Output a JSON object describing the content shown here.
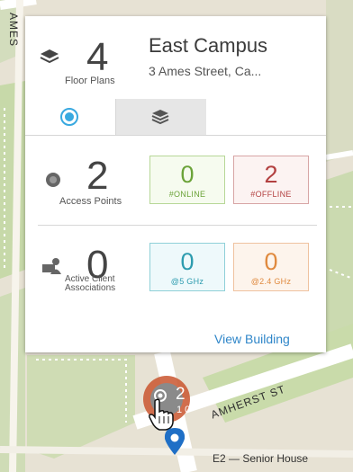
{
  "map": {
    "street_top_left": "AMES",
    "street_right": "AMHERST ST",
    "place_label": "E2 — Senior House",
    "colors": {
      "land": "#e9e4d8",
      "park": "#c9dcae",
      "road": "#ffffff"
    }
  },
  "header": {
    "floor_plans_count": "4",
    "floor_plans_label": "Floor Plans",
    "building_name": "East Campus",
    "building_address": "3 Ames Street, Ca..."
  },
  "tabs": [
    {
      "icon": "access-point-icon",
      "active": true
    },
    {
      "icon": "layers-icon",
      "active": false
    }
  ],
  "access_points": {
    "count": "2",
    "label": "Access Points",
    "online_value": "0",
    "online_label": "#ONLINE",
    "offline_value": "2",
    "offline_label": "#OFFLINE"
  },
  "clients": {
    "count": "0",
    "label_line1": "Active Client",
    "label_line2": "Associations",
    "ghz5_value": "0",
    "ghz5_label": "@5 GHz",
    "ghz24_value": "0",
    "ghz24_label": "@2.4 GHz"
  },
  "footer": {
    "link_label": "View Building"
  },
  "marker": {
    "count": "2",
    "sub": "1 0",
    "color": "#c9552e"
  },
  "colors": {
    "online": "#6ba339",
    "offline": "#b34141",
    "ghz5": "#2d9caf",
    "ghz24": "#e08a3f",
    "link": "#2f86c9",
    "tab_active_icon": "#39a9e0"
  }
}
